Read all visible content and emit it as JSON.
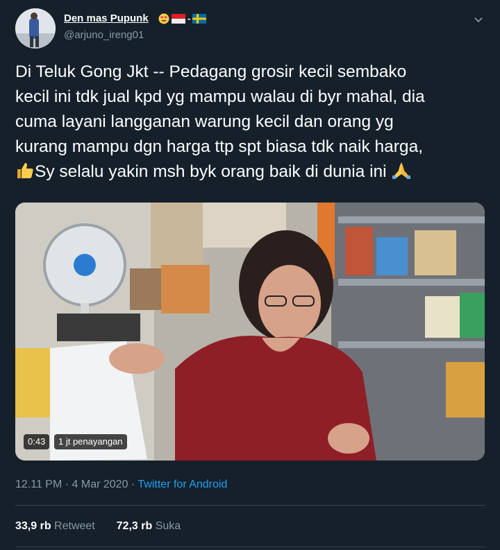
{
  "tweet": {
    "author": {
      "display_name": "Den mas Pupunk",
      "name_emojis": [
        "smiling-face-heart-eyes",
        "flag-indonesia",
        "flag-sweden"
      ],
      "handle": "@arjuno_ireng01"
    },
    "menu_icon": "chevron-down-icon",
    "text_lines": [
      "Di Teluk Gong Jkt -- Pedagang grosir kecil sembako",
      "kecil ini tdk jual kpd yg mampu walau di byr mahal, dia",
      "cuma layani langganan warung kecil dan orang yg",
      "kurang mampu dgn harga ttp spt biasa tdk naik harga,",
      "Sy  selalu yakin msh byk orang baik di dunia ini"
    ],
    "text_emojis": [
      "thumbs-up",
      "folded-hands"
    ],
    "media": {
      "duration": "0:43",
      "views": "1 jt penayangan"
    },
    "time": "12.11 PM",
    "date": "4 Mar 2020",
    "separator": "·",
    "source": "Twitter for Android",
    "retweets_count": "33,9 rb",
    "retweets_label": "Retweet",
    "likes_count": "72,3 rb",
    "likes_label": "Suka"
  },
  "colors": {
    "background": "#15202b",
    "muted_text": "#8899a6",
    "link": "#1da1f2",
    "divider": "#38444d"
  }
}
